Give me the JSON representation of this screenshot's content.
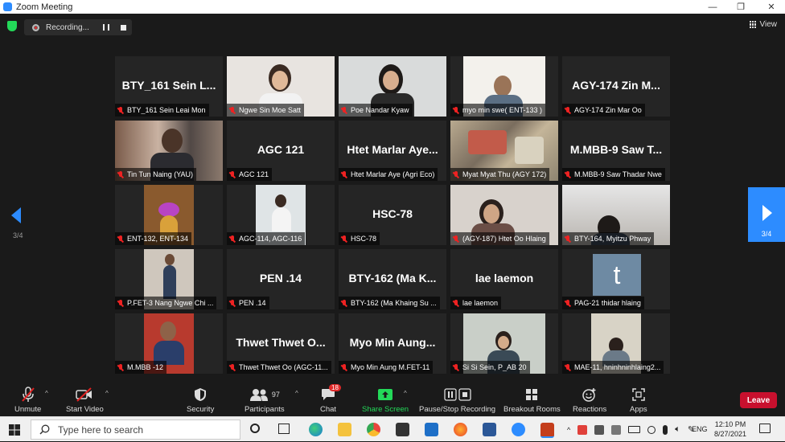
{
  "window": {
    "title": "Zoom Meeting"
  },
  "recording": {
    "label": "Recording..."
  },
  "view": {
    "label": "View"
  },
  "paging": {
    "left": "3/4",
    "right": "3/4"
  },
  "participants": [
    {
      "label": "BTY_161 Sein Leai Mon",
      "display": "BTY_161 Sein L..."
    },
    {
      "label": "Ngwe Sin Moe Satt",
      "display": ""
    },
    {
      "label": "Poe Nandar Kyaw",
      "display": ""
    },
    {
      "label": "myo min swe( ENT-133 )",
      "display": ""
    },
    {
      "label": "AGY-174 Zin Mar Oo",
      "display": "AGY-174 Zin M..."
    },
    {
      "label": "Tin Tun Naing (YAU)",
      "display": ""
    },
    {
      "label": "AGC 121",
      "display": "AGC 121"
    },
    {
      "label": "Htet Marlar Aye (Agri Eco)",
      "display": "Htet Marlar Aye..."
    },
    {
      "label": "Myat Myat Thu (AGY 172)",
      "display": ""
    },
    {
      "label": "M.MBB-9 Saw Thadar Nwe",
      "display": "M.MBB-9 Saw T..."
    },
    {
      "label": "ENT-132, ENT-134",
      "display": ""
    },
    {
      "label": "AGC-114, AGC-116",
      "display": ""
    },
    {
      "label": "HSC-78",
      "display": "HSC-78"
    },
    {
      "label": "(AGY-187) Htet Oo Hlaing",
      "display": ""
    },
    {
      "label": "BTY-164, Myitzu Phway",
      "display": ""
    },
    {
      "label": "P.FET-3 Nang Ngwe Chi ...",
      "display": ""
    },
    {
      "label": "PEN .14",
      "display": "PEN .14"
    },
    {
      "label": "BTY-162 (Ma Khaing Su ...",
      "display": "BTY-162 (Ma K..."
    },
    {
      "label": "lae laemon",
      "display": "lae laemon"
    },
    {
      "label": "PAG-21 thidar hlaing",
      "display": "",
      "avatar": "t"
    },
    {
      "label": "M.MBB -12",
      "display": ""
    },
    {
      "label": "Thwet Thwet Oo (AGC-11...",
      "display": "Thwet Thwet O..."
    },
    {
      "label": "Myo Min Aung M.FET-11",
      "display": "Myo Min Aung..."
    },
    {
      "label": "Si Si Sein, P_AB 20",
      "display": ""
    },
    {
      "label": "MAE-11, hninhninhlaing2...",
      "display": ""
    }
  ],
  "toolbar": {
    "unmute": "Unmute",
    "start_video": "Start Video",
    "security": "Security",
    "participants": "Participants",
    "participants_count": "97",
    "chat": "Chat",
    "chat_badge": "18",
    "share_screen": "Share Screen",
    "pause_stop": "Pause/Stop Recording",
    "breakout": "Breakout Rooms",
    "reactions": "Reactions",
    "apps": "Apps",
    "leave": "Leave"
  },
  "taskbar": {
    "search_placeholder": "Type here to search",
    "lang": "ENG",
    "time": "12:10 PM",
    "date": "8/27/2021"
  },
  "colors": {
    "accent": "#2d8cff",
    "leave": "#c8102e",
    "share": "#23d959",
    "muted": "#e22222"
  }
}
